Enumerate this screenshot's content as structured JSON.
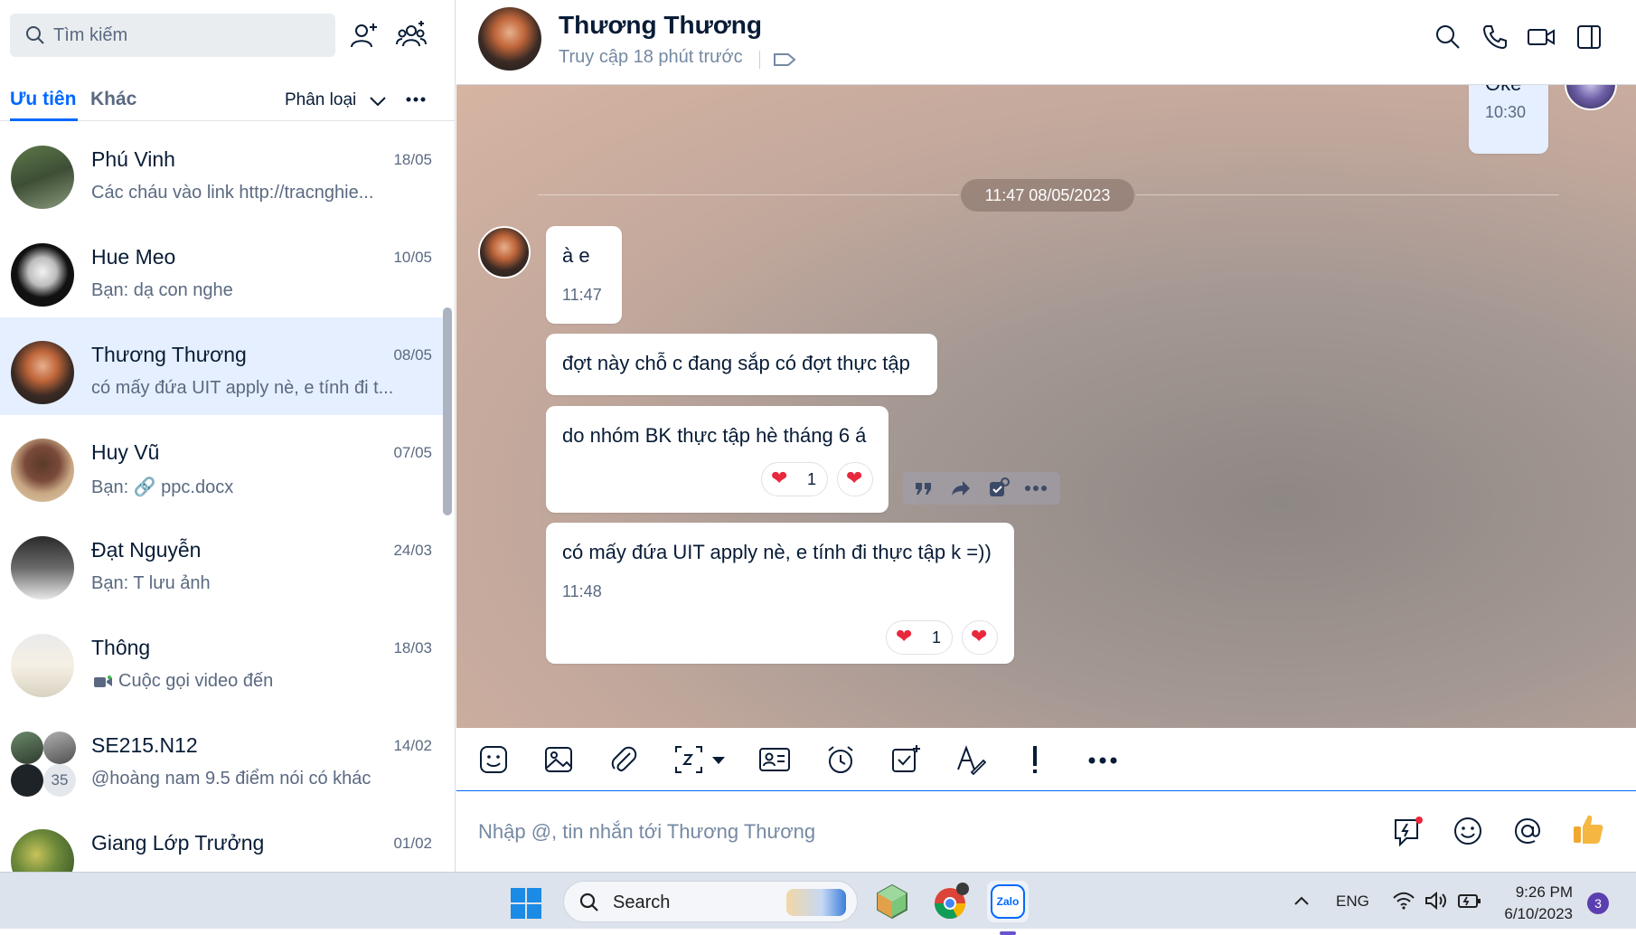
{
  "sidebar": {
    "search_placeholder": "Tìm kiếm",
    "tabs": {
      "priority": "Ưu tiên",
      "other": "Khác"
    },
    "classify_label": "Phân loại",
    "conversations": [
      {
        "name": "Phú Vinh",
        "date": "18/05",
        "preview": "Các cháu vào link http://tracnghie..."
      },
      {
        "name": "Hue Meo",
        "date": "10/05",
        "preview": "Bạn: dạ con nghe"
      },
      {
        "name": "Thương Thương",
        "date": "08/05",
        "preview": "có mấy đứa UIT apply nè, e tính đi t..."
      },
      {
        "name": "Huy Vũ",
        "date": "07/05",
        "preview": "Bạn: 🔗 ppc.docx"
      },
      {
        "name": "Đạt Nguyễn",
        "date": "24/03",
        "preview": "Bạn: T lưu ảnh"
      },
      {
        "name": "Thông",
        "date": "18/03",
        "preview": "Cuộc gọi video đến"
      },
      {
        "name": "SE215.N12",
        "date": "14/02",
        "preview": "@hoàng nam 9.5 điểm nói có khác",
        "member_count": "35"
      },
      {
        "name": "Giang Lớp Trưởng",
        "date": "01/02",
        "preview": ""
      }
    ]
  },
  "chat": {
    "header": {
      "name": "Thương Thương",
      "status": "Truy cập 18 phút trước"
    },
    "prev_message": {
      "text": "Oke",
      "time": "10:30"
    },
    "date_separator": "11:47 08/05/2023",
    "messages": [
      {
        "text": "à e",
        "time": "11:47"
      },
      {
        "text": "đợt này chỗ c đang sắp có đợt thực tập"
      },
      {
        "text": "do nhóm BK thực tập hè tháng 6 á",
        "reaction_count": "1"
      },
      {
        "text": "có mấy đứa UIT apply nè, e tính đi thực tập k =))",
        "time": "11:48",
        "reaction_count": "1"
      }
    ],
    "composer_placeholder": "Nhập @, tin nhắn tới Thương Thương"
  },
  "taskbar": {
    "search_label": "Search",
    "language": "ENG",
    "time": "9:26 PM",
    "date": "6/10/2023",
    "notification_count": "3",
    "zalo_label": "Zalo"
  },
  "colors": {
    "accent": "#0068ff",
    "active_row": "#e5efff",
    "heart": "#e8283c"
  }
}
